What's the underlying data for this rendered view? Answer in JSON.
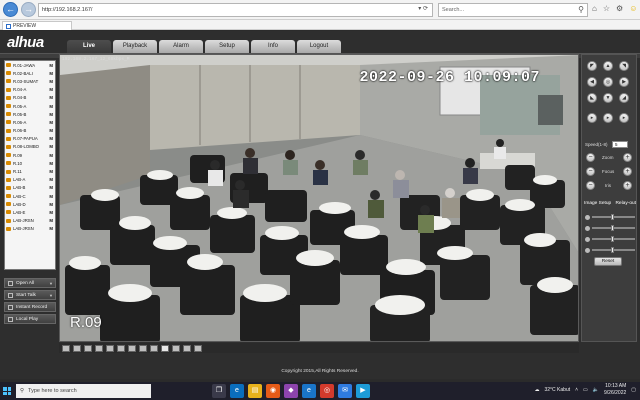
{
  "browser": {
    "back": "←",
    "forward": "→",
    "address": "http://192.168.2.167/",
    "address_controls": "▾ ⟳",
    "search_placeholder": "Search...",
    "tab_title": "PREVIEW"
  },
  "app": {
    "brand": "alhua",
    "nav_tabs": [
      "Live",
      "Playback",
      "Alarm",
      "Setup",
      "Info",
      "Logout"
    ],
    "active_tab": "Live",
    "copyright": "Copyright 2015,All Rights Reserved."
  },
  "devices": [
    {
      "label": "R.01-JAWA",
      "flag": "M"
    },
    {
      "label": "R.02-BALI",
      "flag": "M"
    },
    {
      "label": "R.03-SUMAT",
      "flag": "M"
    },
    {
      "label": "R.04-A",
      "flag": "M"
    },
    {
      "label": "R.04-B",
      "flag": "M"
    },
    {
      "label": "R.05-A",
      "flag": "M"
    },
    {
      "label": "R.05-B",
      "flag": "M"
    },
    {
      "label": "R.06-A",
      "flag": "M"
    },
    {
      "label": "R.06-B",
      "flag": "M"
    },
    {
      "label": "R.07-PAPUA",
      "flag": "M"
    },
    {
      "label": "R.08-LOMBO",
      "flag": "M"
    },
    {
      "label": "R.09",
      "flag": "M"
    },
    {
      "label": "R.10",
      "flag": "M"
    },
    {
      "label": "R.11",
      "flag": "M"
    },
    {
      "label": "LAB-A",
      "flag": "M"
    },
    {
      "label": "LAB-B",
      "flag": "M"
    },
    {
      "label": "LAB-C",
      "flag": "M"
    },
    {
      "label": "LAB-D",
      "flag": "M"
    },
    {
      "label": "LAB-E",
      "flag": "M"
    },
    {
      "label": "LAB-JRSN",
      "flag": "M"
    },
    {
      "label": "LAB-JRSN",
      "flag": "M"
    }
  ],
  "left_buttons": {
    "open_all": "Open All",
    "start_talk": "Start Talk",
    "instant_record": "Instant Record",
    "local_play": "Local Play"
  },
  "video": {
    "info": "192.168.2.167_12_68kbps_M",
    "timestamp": "2022-09-26 10:09:07",
    "camera_name": "R.09"
  },
  "ptz": {
    "speed_label": "Speed(1-8)",
    "speed_value": "5",
    "zoom_label": "Zoom",
    "focus_label": "Focus",
    "iris_label": "Iris",
    "image_setup": "Image Setup",
    "relay_out": "Relay-out",
    "reset": "Reset"
  },
  "taskbar": {
    "search_placeholder": "Type here to search",
    "weather": "32°C  Kabut",
    "time": "10:13 AM",
    "date": "9/26/2022"
  }
}
